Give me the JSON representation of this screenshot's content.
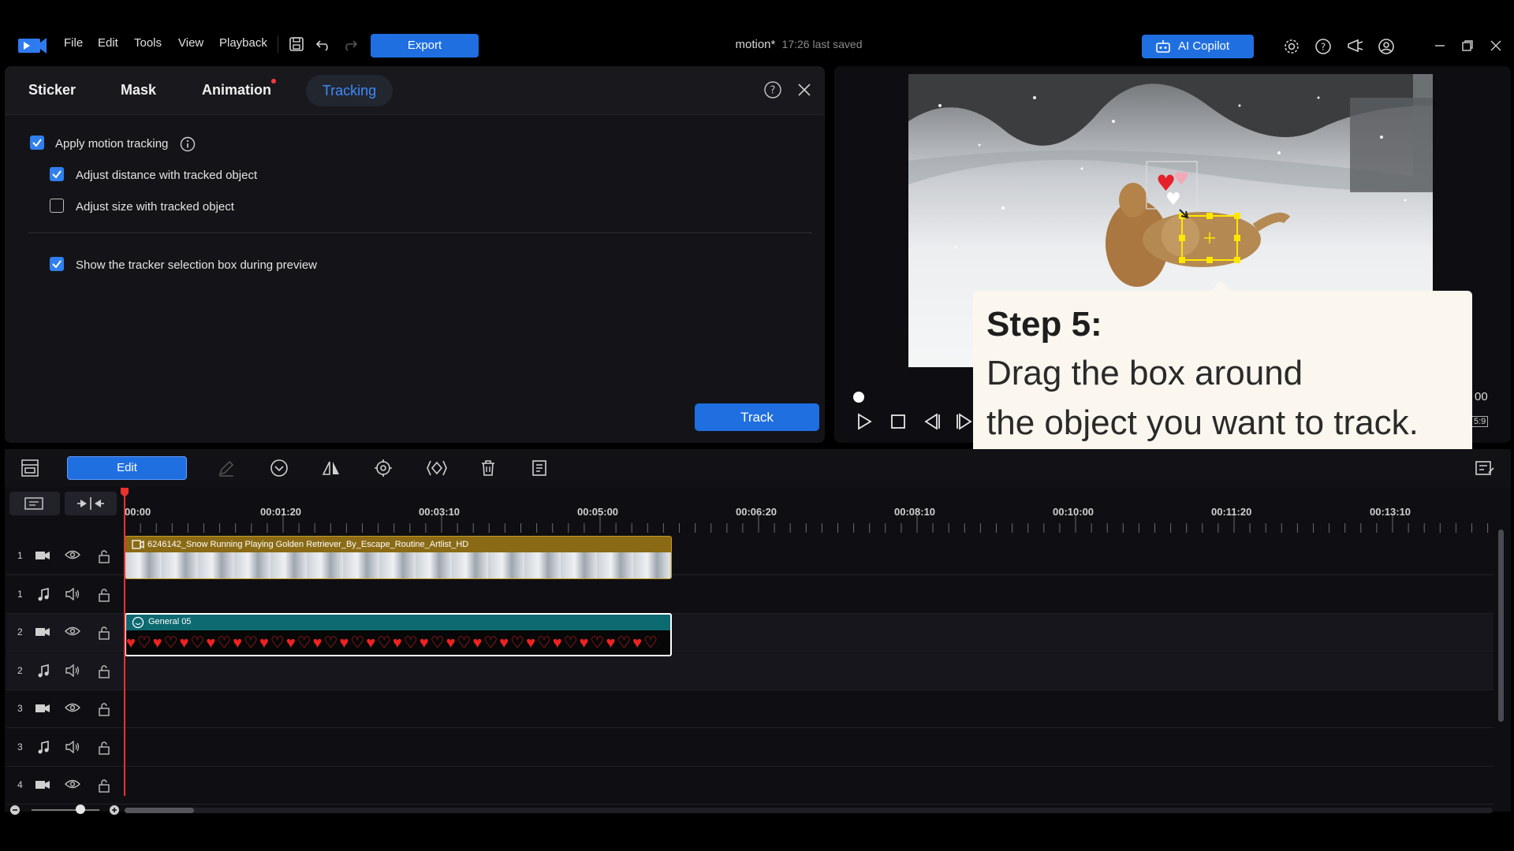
{
  "menu": {
    "items": [
      "File",
      "Edit",
      "Tools",
      "View",
      "Playback"
    ],
    "export_label": "Export"
  },
  "document": {
    "name": "motion*",
    "saved": "17:26 last saved"
  },
  "copilot_label": "AI Copilot",
  "panel": {
    "tabs": [
      "Sticker",
      "Mask",
      "Animation",
      "Tracking"
    ],
    "active_tab": "Tracking",
    "options": [
      {
        "label": "Apply motion tracking",
        "checked": true
      },
      {
        "label": "Adjust distance with tracked object",
        "checked": true
      },
      {
        "label": "Adjust size with tracked object",
        "checked": false
      },
      {
        "label": "Show the tracker selection box during preview",
        "checked": true
      }
    ],
    "track_label": "Track"
  },
  "preview": {
    "time_tail": "00",
    "ratio_tail": "5:9"
  },
  "tooltip": {
    "step": "Step 5:",
    "line1": "Drag the box around",
    "line2": "the object you want to track."
  },
  "timeline": {
    "edit_label": "Edit",
    "ticks": [
      "00:00",
      "00:01:20",
      "00:03:10",
      "00:05:00",
      "00:06:20",
      "00:08:10",
      "00:10:00",
      "00:11:20",
      "00:13:10"
    ],
    "tracks": [
      {
        "num": "1",
        "kind": "video"
      },
      {
        "num": "1",
        "kind": "audio"
      },
      {
        "num": "2",
        "kind": "video"
      },
      {
        "num": "2",
        "kind": "audio"
      },
      {
        "num": "3",
        "kind": "video"
      },
      {
        "num": "3",
        "kind": "audio"
      },
      {
        "num": "4",
        "kind": "video"
      }
    ],
    "video_clip_title": "6246142_Snow Running Playing Golden Retriever_By_Escape_Routine_Artlist_HD",
    "sticker_clip_title": "General 05",
    "hearts": "♥♡♥♡♥♡♥♡♥♡♥♡♥♡♥♡♥♡♥♡♥♡♥♡♥♡♥♡♥♡♥♡♥♡♥♡♥♡♥♡"
  },
  "colors": {
    "accent": "#1f6fe0",
    "tab_active": "#3d8bff",
    "video_clip": "#8a6a14",
    "sticker_clip": "#0c6a70",
    "playhead": "#e8322f"
  }
}
